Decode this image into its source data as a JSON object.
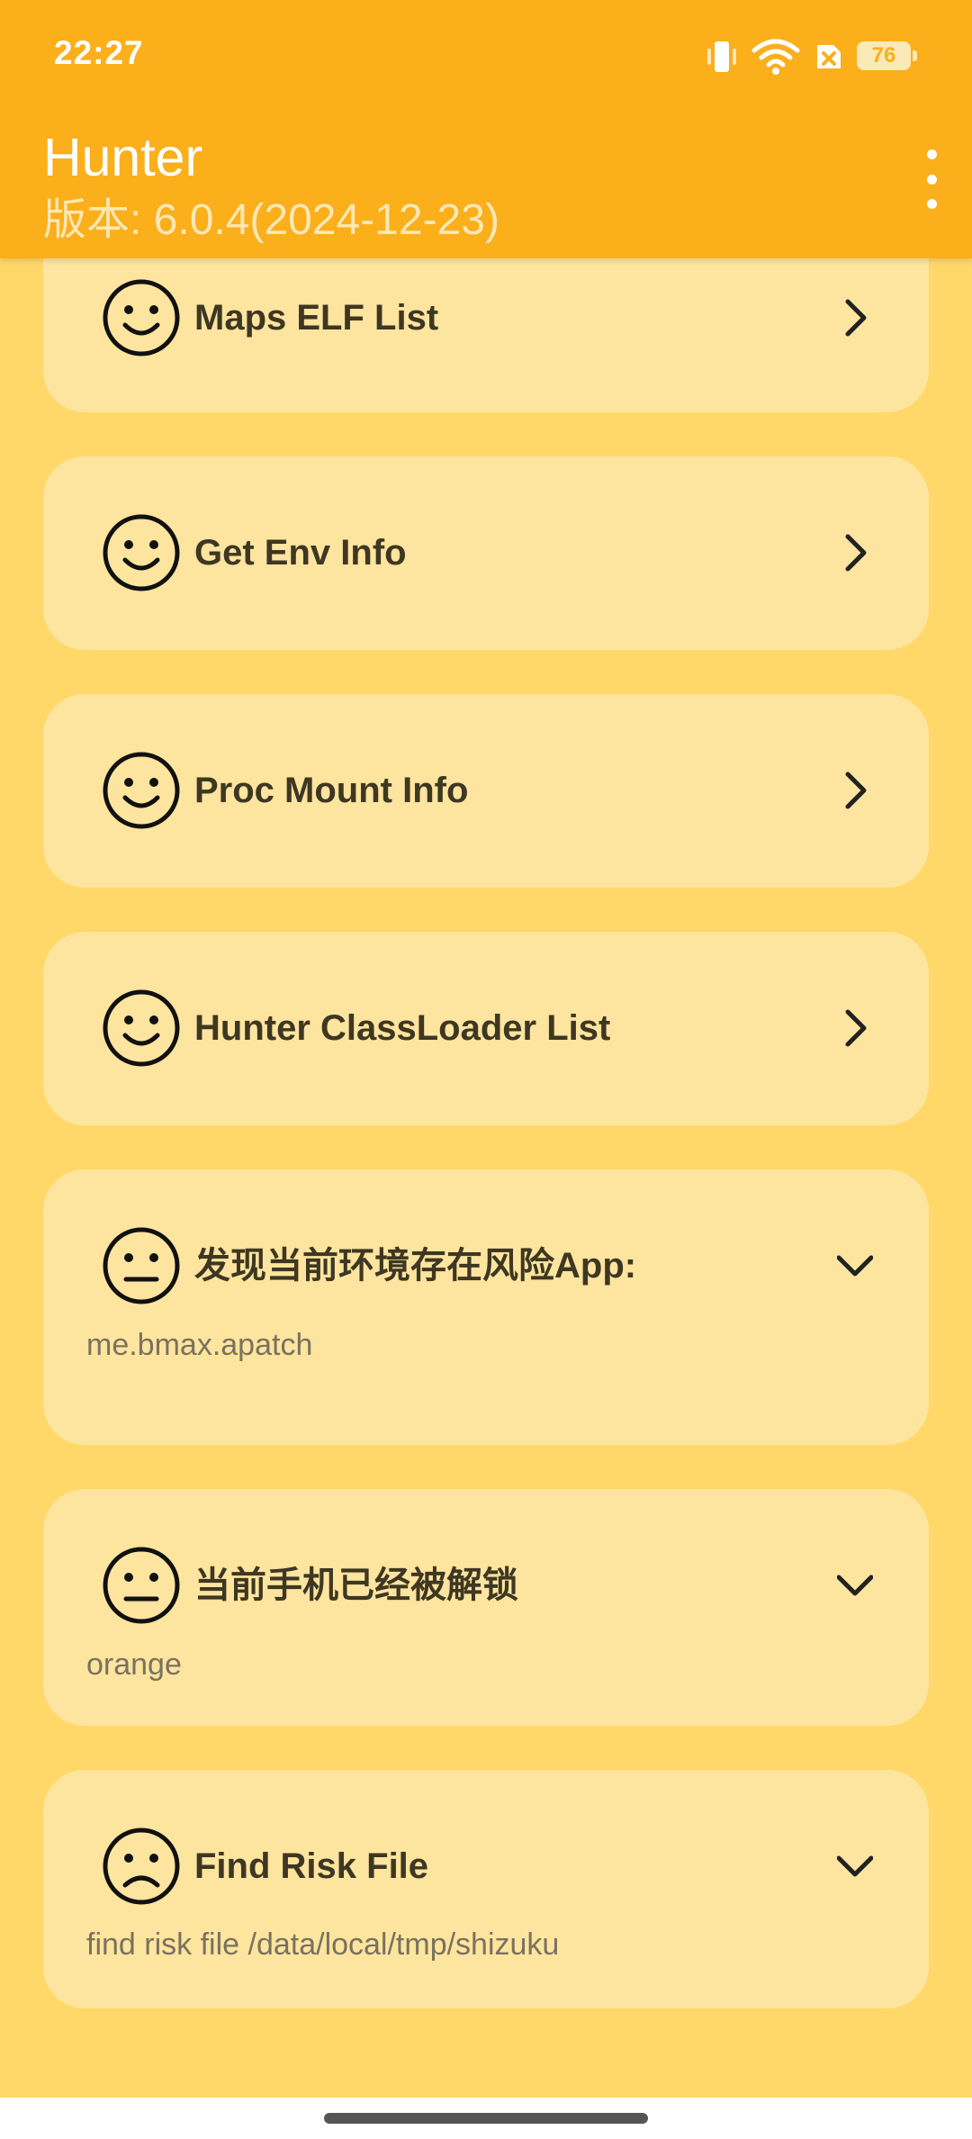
{
  "status_bar": {
    "time": "22:27",
    "battery": "76",
    "icons": [
      "vibrate-icon",
      "wifi-icon",
      "sim-x-icon",
      "battery-icon"
    ]
  },
  "app_bar": {
    "title": "Hunter",
    "subtitle": "版本: 6.0.4(2024-12-23)",
    "menu_icon": "more-vert-icon"
  },
  "colors": {
    "app_bar": "#FAAF1B",
    "background": "#FFD869",
    "card": "#FEE59F",
    "card_text": "#3E3722",
    "detail_text": "#7A725E"
  },
  "cards": [
    {
      "title": "Maps ELF List",
      "face": "smile",
      "action": "chevron-right"
    },
    {
      "title": "Get Env Info",
      "face": "smile",
      "action": "chevron-right"
    },
    {
      "title": "Proc Mount Info",
      "face": "smile",
      "action": "chevron-right"
    },
    {
      "title": "Hunter ClassLoader List",
      "face": "smile",
      "action": "chevron-right"
    },
    {
      "title": "发现当前环境存在风险App:",
      "detail": "me.bmax.apatch",
      "face": "neutral",
      "action": "chevron-down"
    },
    {
      "title": "当前手机已经被解锁",
      "detail": "orange",
      "face": "neutral",
      "action": "chevron-down"
    },
    {
      "title": "Find Risk File",
      "detail": "find risk file /data/local/tmp/shizuku",
      "face": "sad",
      "action": "chevron-down"
    }
  ]
}
